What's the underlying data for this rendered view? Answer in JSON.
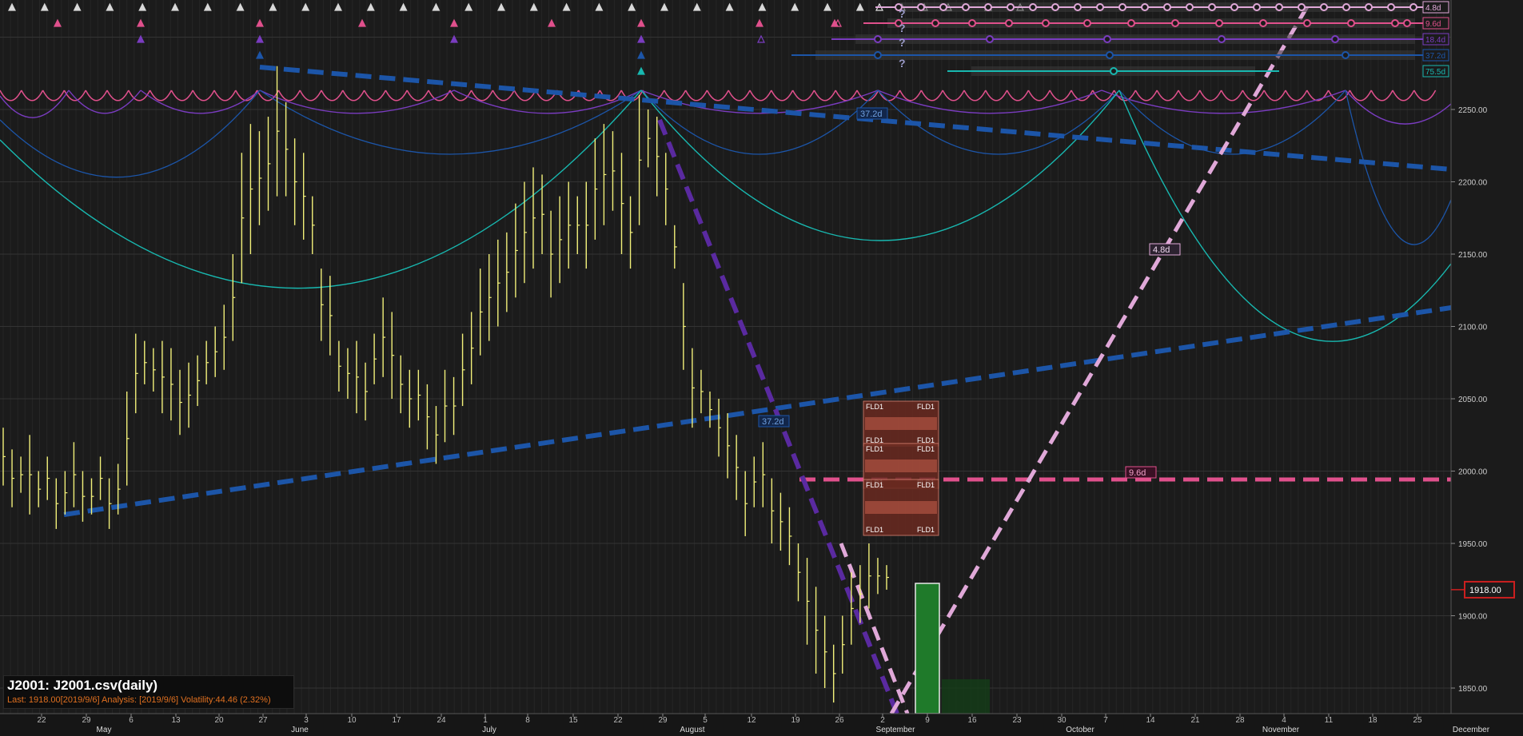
{
  "chart_data": {
    "type": "bar",
    "title": "J2001: J2001.csv(daily)",
    "status_line": "Last: 1918.00[2019/9/6] Analysis: [2019/9/6] Volatility:44.46 (2.32%)",
    "last_price": "1918.00",
    "ylim": [
      1832,
      2330
    ],
    "y_ticks": [
      "1850.00",
      "1900.00",
      "1950.00",
      "2000.00",
      "2050.00",
      "2100.00",
      "2150.00",
      "2200.00",
      "2250.00"
    ],
    "x_day_labels": [
      "22",
      "29",
      "6",
      "13",
      "20",
      "27",
      "3",
      "10",
      "17",
      "24",
      "1",
      "8",
      "15",
      "22",
      "29",
      "5",
      "12",
      "19",
      "26",
      "2",
      "9",
      "16",
      "23",
      "30",
      "7",
      "14",
      "21",
      "28",
      "4",
      "11",
      "18",
      "25"
    ],
    "x_month_labels": [
      "May",
      "June",
      "July",
      "August",
      "September",
      "October",
      "November",
      "December"
    ],
    "price_bars": [
      [
        1990,
        2030
      ],
      [
        1975,
        2015
      ],
      [
        1985,
        2010
      ],
      [
        1970,
        2025
      ],
      [
        1975,
        2000
      ],
      [
        1980,
        2010
      ],
      [
        1960,
        1995
      ],
      [
        1970,
        2000
      ],
      [
        1975,
        2020
      ],
      [
        1965,
        2000
      ],
      [
        1970,
        1995
      ],
      [
        1980,
        2010
      ],
      [
        1960,
        1995
      ],
      [
        1970,
        2005
      ],
      [
        1990,
        2055
      ],
      [
        2040,
        2095
      ],
      [
        2060,
        2090
      ],
      [
        2055,
        2085
      ],
      [
        2040,
        2090
      ],
      [
        2035,
        2085
      ],
      [
        2025,
        2070
      ],
      [
        2030,
        2075
      ],
      [
        2045,
        2080
      ],
      [
        2060,
        2090
      ],
      [
        2065,
        2100
      ],
      [
        2070,
        2115
      ],
      [
        2090,
        2150
      ],
      [
        2130,
        2220
      ],
      [
        2150,
        2240
      ],
      [
        2170,
        2235
      ],
      [
        2180,
        2245
      ],
      [
        2190,
        2280
      ],
      [
        2190,
        2255
      ],
      [
        2170,
        2230
      ],
      [
        2160,
        2220
      ],
      [
        2150,
        2190
      ],
      [
        2090,
        2140
      ],
      [
        2080,
        2135
      ],
      [
        2055,
        2090
      ],
      [
        2050,
        2085
      ],
      [
        2040,
        2090
      ],
      [
        2035,
        2075
      ],
      [
        2060,
        2095
      ],
      [
        2065,
        2120
      ],
      [
        2050,
        2110
      ],
      [
        2040,
        2080
      ],
      [
        2030,
        2070
      ],
      [
        2035,
        2070
      ],
      [
        2015,
        2060
      ],
      [
        2005,
        2045
      ],
      [
        2020,
        2070
      ],
      [
        2025,
        2065
      ],
      [
        2045,
        2095
      ],
      [
        2060,
        2110
      ],
      [
        2080,
        2140
      ],
      [
        2090,
        2150
      ],
      [
        2100,
        2160
      ],
      [
        2110,
        2165
      ],
      [
        2120,
        2185
      ],
      [
        2130,
        2200
      ],
      [
        2140,
        2210
      ],
      [
        2150,
        2205
      ],
      [
        2120,
        2180
      ],
      [
        2130,
        2190
      ],
      [
        2140,
        2200
      ],
      [
        2150,
        2190
      ],
      [
        2140,
        2200
      ],
      [
        2160,
        2230
      ],
      [
        2170,
        2240
      ],
      [
        2180,
        2235
      ],
      [
        2150,
        2220
      ],
      [
        2140,
        2190
      ],
      [
        2170,
        2260
      ],
      [
        2210,
        2250
      ],
      [
        2190,
        2245
      ],
      [
        2170,
        2220
      ],
      [
        2140,
        2170
      ],
      [
        2070,
        2130
      ],
      [
        2030,
        2085
      ],
      [
        2040,
        2070
      ],
      [
        2030,
        2055
      ],
      [
        2010,
        2050
      ],
      [
        1995,
        2040
      ],
      [
        1980,
        2025
      ],
      [
        1955,
        2000
      ],
      [
        1975,
        2010
      ],
      [
        1975,
        2020
      ],
      [
        1950,
        1995
      ],
      [
        1945,
        1985
      ],
      [
        1935,
        1975
      ],
      [
        1910,
        1950
      ],
      [
        1880,
        1940
      ],
      [
        1860,
        1920
      ],
      [
        1850,
        1900
      ],
      [
        1840,
        1880
      ],
      [
        1860,
        1900
      ],
      [
        1880,
        1930
      ],
      [
        1895,
        1935
      ],
      [
        1905,
        1950
      ],
      [
        1915,
        1940
      ],
      [
        1918,
        1935
      ]
    ],
    "fld_labels": [
      "FLD1",
      "FLD1",
      "FLD1",
      "FLD1",
      "FLD1",
      "FLD1",
      "FLD1",
      "FLD1",
      "FLD1",
      "FLD1",
      "FLD1",
      "FLD1"
    ],
    "cycles": [
      {
        "name": "4.8d",
        "color": "#e0a8d8"
      },
      {
        "name": "9.6d",
        "color": "#e0508c"
      },
      {
        "name": "18.4d",
        "color": "#7a3cc0"
      },
      {
        "name": "37.2d",
        "color": "#1c55a8"
      },
      {
        "name": "75.5d",
        "color": "#18b8b0"
      }
    ],
    "annotations": {
      "downtrend_label": "37.2d",
      "uptrend_label": "37.2d",
      "fld_label": "9.6d",
      "steep_label": "4.8d"
    },
    "colors": {
      "background": "#1b1b1b",
      "price": "#f2f07a",
      "grid": "#2c2c2c",
      "last_price_box": "#cc1f1f"
    }
  }
}
